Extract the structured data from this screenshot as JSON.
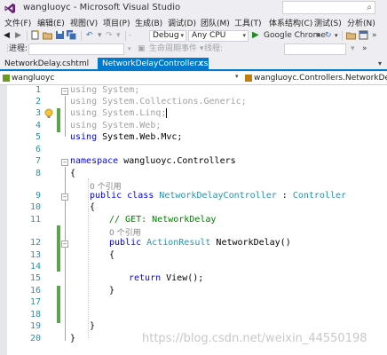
{
  "window": {
    "title": "wangluoyc - Microsoft Visual Studio"
  },
  "menu": [
    {
      "label": "文件(F)"
    },
    {
      "label": "编辑(E)"
    },
    {
      "label": "视图(V)"
    },
    {
      "label": "项目(P)"
    },
    {
      "label": "生成(B)"
    },
    {
      "label": "调试(D)"
    },
    {
      "label": "团队(M)"
    },
    {
      "label": "工具(T)"
    },
    {
      "label": "体系结构(C)"
    },
    {
      "label": "测试(S)"
    },
    {
      "label": "分析(N)"
    }
  ],
  "toolbar": {
    "config": "Debug",
    "platform": "Any CPU",
    "run_label": "Google Chrome",
    "process_label": "进程:",
    "lifecycle_label": "生命周期事件 ▾",
    "thread_label": "线程:"
  },
  "tabs": [
    {
      "label": "NetworkDelay.cshtml",
      "active": false
    },
    {
      "label": "NetworkDelayController.cs",
      "active": true
    }
  ],
  "navbar": {
    "project": "wangluoyc",
    "member": "wangluoyc.Controllers.NetworkDelayControlle"
  },
  "editor": {
    "line_numbers": [
      "1",
      "2",
      "3",
      "4",
      "5",
      "6",
      "7",
      "8",
      "9",
      "10",
      "11",
      "12",
      "13",
      "14",
      "15",
      "16",
      "17",
      "18",
      "19",
      "20"
    ],
    "lines": {
      "l1_kw": "using",
      "l1_rest": " System;",
      "l2_kw": "using",
      "l2_rest": " System.Collections.Generic;",
      "l3_kw": "using",
      "l3_rest": " System.Linq;",
      "l4_kw": "using",
      "l4_rest": " System.Web;",
      "l5_kw": "using",
      "l5_rest": " System.Web.Mvc;",
      "l7_kw": "namespace",
      "l7_rest": " wangluoyc.Controllers",
      "l8": "{",
      "ref1": "0 个引用",
      "l9_kw1": "public",
      "l9_kw2": "class",
      "l9_type": "NetworkDelayController",
      "l9_colon": " : ",
      "l9_base": "Controller",
      "l10": "{",
      "l11_comment": "// GET: NetworkDelay",
      "ref2": "0 个引用",
      "l12_kw": "public",
      "l12_type": "ActionResult",
      "l12_rest": " NetworkDelay()",
      "l13": "{",
      "l15_kw": "return",
      "l15_rest": " View();",
      "l16": "}",
      "l19": "}",
      "l20": "}"
    }
  },
  "watermark": "https://blog.csdn.net/weixin_44550198",
  "colors": {
    "keyword": "#0000ff",
    "type": "#2b91af",
    "comment": "#008000",
    "accent": "#007acc",
    "change_bar": "#57a64a"
  }
}
